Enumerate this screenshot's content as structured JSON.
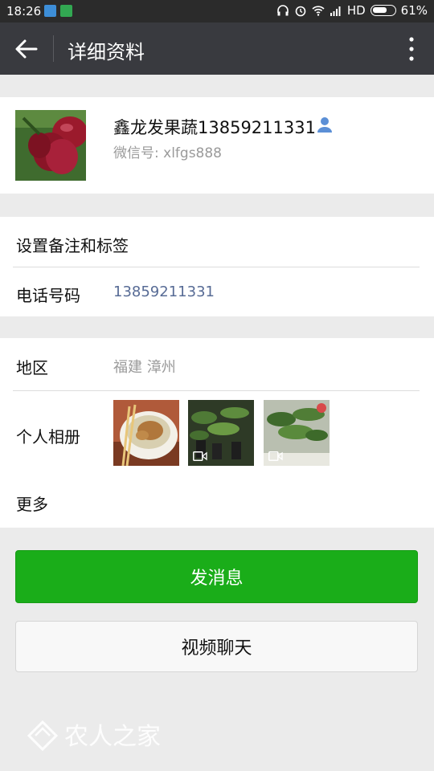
{
  "status_bar": {
    "time": "18:26",
    "network": "HD",
    "battery": "61%"
  },
  "header": {
    "title": "详细资料"
  },
  "profile": {
    "name": "鑫龙发果蔬13859211331",
    "wechat_id": "微信号: xlfgs888"
  },
  "settings": {
    "remark_tags_label": "设置备注和标签",
    "phone_label": "电话号码",
    "phone_value": "13859211331"
  },
  "info": {
    "region_label": "地区",
    "region_value": "福建  漳州",
    "album_label": "个人相册",
    "more_label": "更多"
  },
  "actions": {
    "send_message": "发消息",
    "video_chat": "视频聊天"
  },
  "watermark": "农人之家",
  "colors": {
    "primary_green": "#1aad19",
    "header_bg": "#393a3f",
    "link_blue": "#576b95"
  }
}
